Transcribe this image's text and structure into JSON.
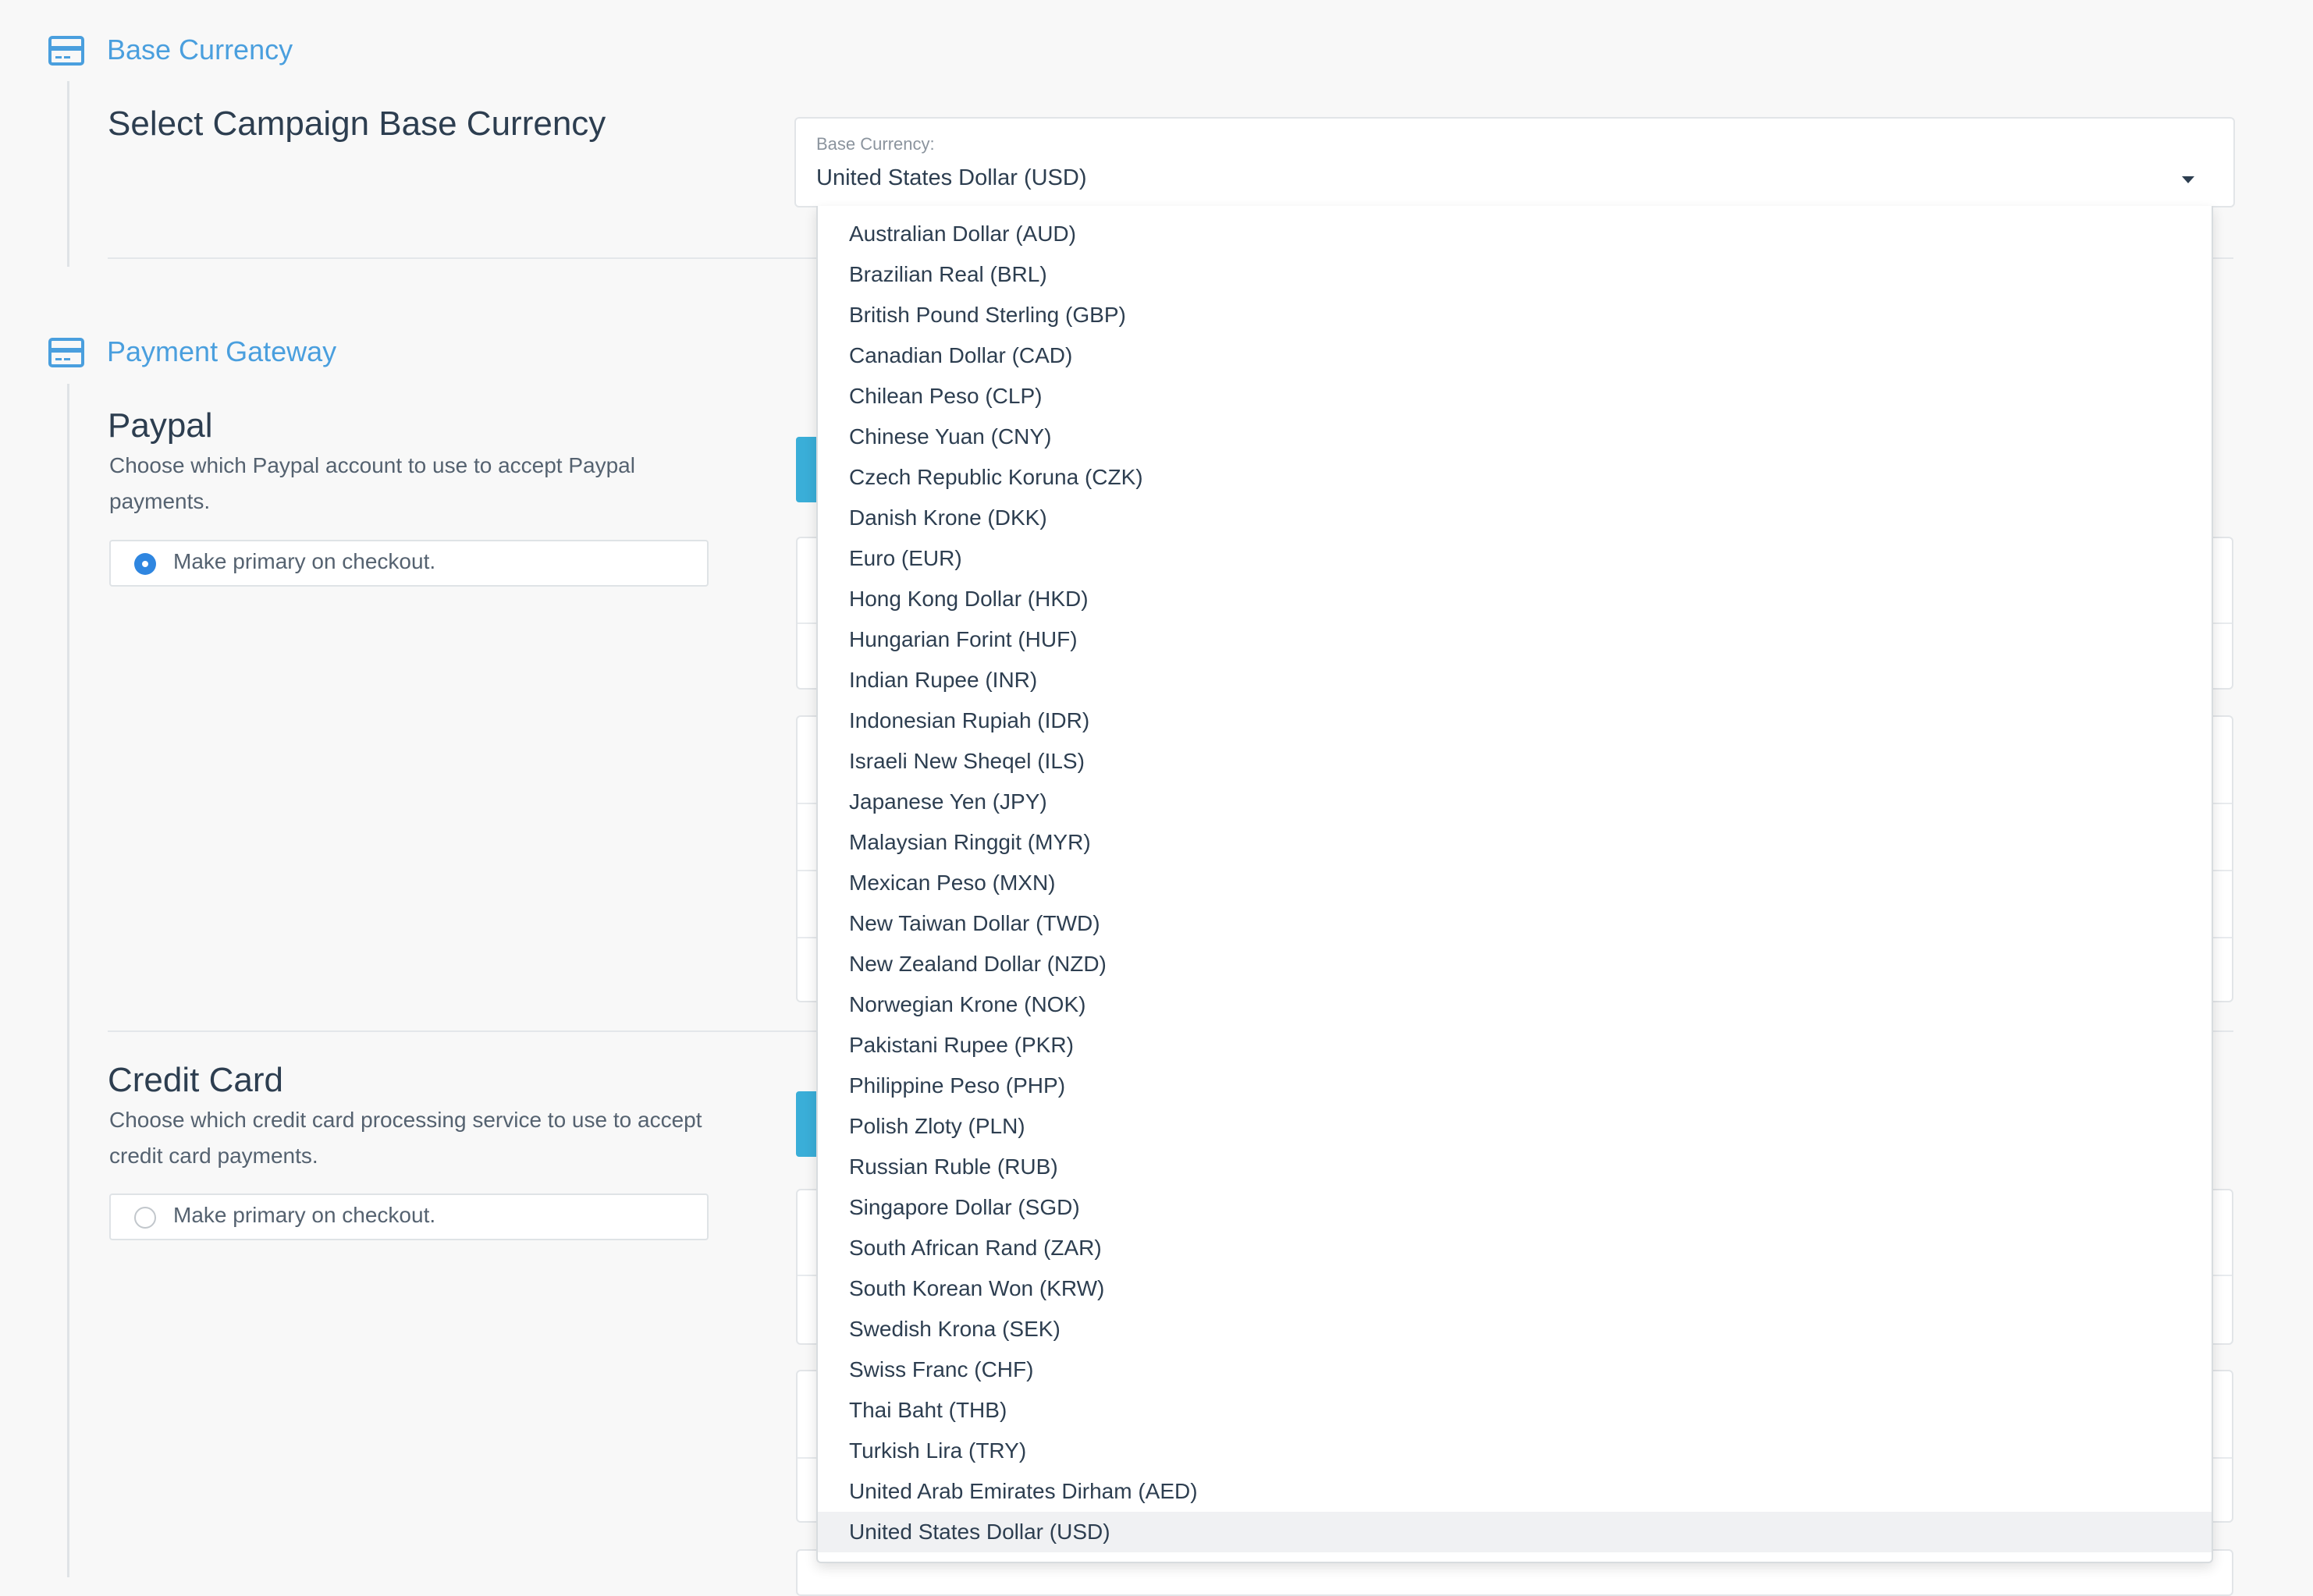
{
  "sections": {
    "base_currency": {
      "title": "Base Currency",
      "icon": "credit-card-icon",
      "heading": "Select Campaign Base Currency"
    },
    "payment_gateway": {
      "title": "Payment Gateway",
      "icon": "credit-card-icon"
    }
  },
  "currency_select": {
    "label": "Base Currency:",
    "value": "United States Dollar (USD)",
    "options": [
      "Australian Dollar (AUD)",
      "Brazilian Real (BRL)",
      "British Pound Sterling (GBP)",
      "Canadian Dollar (CAD)",
      "Chilean Peso (CLP)",
      "Chinese Yuan (CNY)",
      "Czech Republic Koruna (CZK)",
      "Danish Krone (DKK)",
      "Euro (EUR)",
      "Hong Kong Dollar (HKD)",
      "Hungarian Forint (HUF)",
      "Indian Rupee (INR)",
      "Indonesian Rupiah (IDR)",
      "Israeli New Sheqel (ILS)",
      "Japanese Yen (JPY)",
      "Malaysian Ringgit (MYR)",
      "Mexican Peso (MXN)",
      "New Taiwan Dollar (TWD)",
      "New Zealand Dollar (NZD)",
      "Norwegian Krone (NOK)",
      "Pakistani Rupee (PKR)",
      "Philippine Peso (PHP)",
      "Polish Zloty (PLN)",
      "Russian Ruble (RUB)",
      "Singapore Dollar (SGD)",
      "South African Rand (ZAR)",
      "South Korean Won (KRW)",
      "Swedish Krona (SEK)",
      "Swiss Franc (CHF)",
      "Thai Baht (THB)",
      "Turkish Lira (TRY)",
      "United Arab Emirates Dirham (AED)",
      "United States Dollar (USD)"
    ],
    "selected_index": 32
  },
  "paypal": {
    "heading": "Paypal",
    "description": "Choose which Paypal account to use to accept Paypal payments.",
    "primary_label": "Make primary on checkout.",
    "primary_checked": true
  },
  "credit_card": {
    "heading": "Credit Card",
    "description": "Choose which credit card processing service to use to accept credit card payments.",
    "primary_label": "Make primary on checkout.",
    "primary_checked": false
  },
  "colors": {
    "accent": "#4a9fde",
    "radio_checked": "#2f86e0",
    "button_teal": "#3aaed8"
  }
}
